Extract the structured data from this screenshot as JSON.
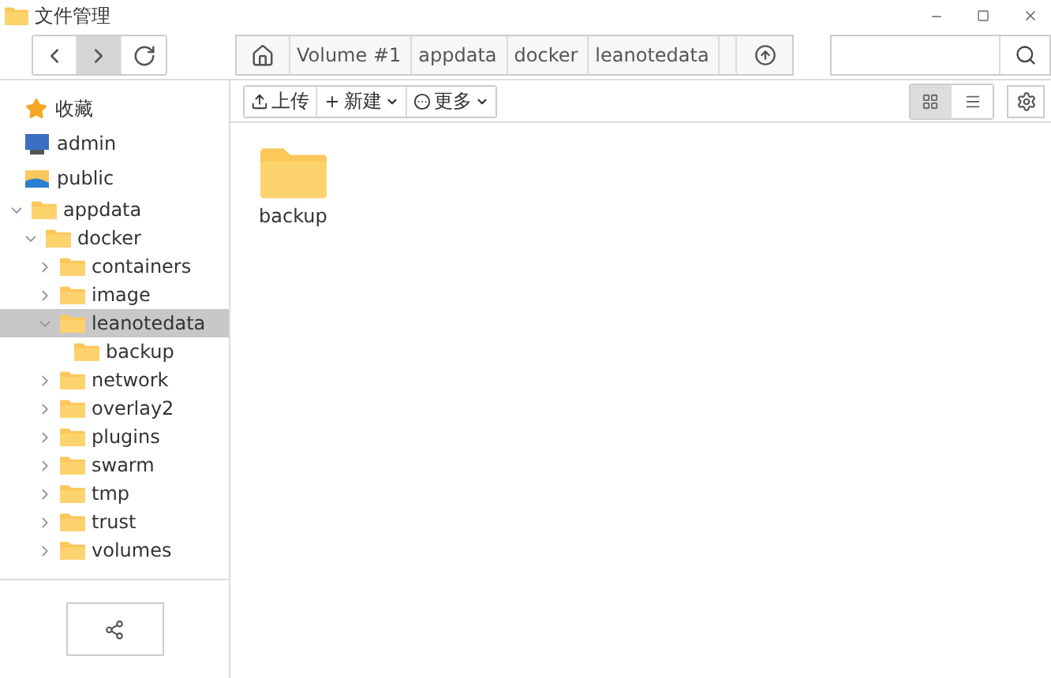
{
  "window": {
    "title": "文件管理"
  },
  "nav_buttons": [
    {
      "kind": "back",
      "active": false
    },
    {
      "kind": "forward",
      "active": true
    },
    {
      "kind": "refresh",
      "active": false
    }
  ],
  "breadcrumb": [
    "Volume #1",
    "appdata",
    "docker",
    "leanotedata"
  ],
  "toolbar": [
    {
      "kind": "upload",
      "label": "上传",
      "dropdown": false
    },
    {
      "kind": "new",
      "label": "新建",
      "dropdown": true
    },
    {
      "kind": "more",
      "label": "更多",
      "dropdown": true
    }
  ],
  "view_buttons": [
    {
      "kind": "grid",
      "selected": true
    },
    {
      "kind": "list",
      "selected": false
    }
  ],
  "shortcuts": [
    {
      "kind": "favorites",
      "label": "收藏"
    },
    {
      "kind": "user",
      "label": "admin"
    },
    {
      "kind": "shared",
      "label": "public"
    }
  ],
  "tree": [
    {
      "label": "appdata",
      "expandable": true,
      "expanded": true,
      "selected": false,
      "children": [
        {
          "label": "docker",
          "expandable": true,
          "expanded": true,
          "selected": false,
          "children": [
            {
              "label": "containers",
              "expandable": true,
              "expanded": false,
              "selected": false
            },
            {
              "label": "image",
              "expandable": true,
              "expanded": false,
              "selected": false
            },
            {
              "label": "leanotedata",
              "expandable": true,
              "expanded": true,
              "selected": true,
              "children": [
                {
                  "label": "backup",
                  "expandable": false,
                  "expanded": false,
                  "selected": false
                }
              ]
            },
            {
              "label": "network",
              "expandable": true,
              "expanded": false,
              "selected": false
            },
            {
              "label": "overlay2",
              "expandable": true,
              "expanded": false,
              "selected": false
            },
            {
              "label": "plugins",
              "expandable": true,
              "expanded": false,
              "selected": false
            },
            {
              "label": "swarm",
              "expandable": true,
              "expanded": false,
              "selected": false
            },
            {
              "label": "tmp",
              "expandable": true,
              "expanded": false,
              "selected": false
            },
            {
              "label": "trust",
              "expandable": true,
              "expanded": false,
              "selected": false
            },
            {
              "label": "volumes",
              "expandable": true,
              "expanded": false,
              "selected": false
            }
          ]
        }
      ]
    }
  ],
  "files": [
    {
      "name": "backup"
    }
  ]
}
